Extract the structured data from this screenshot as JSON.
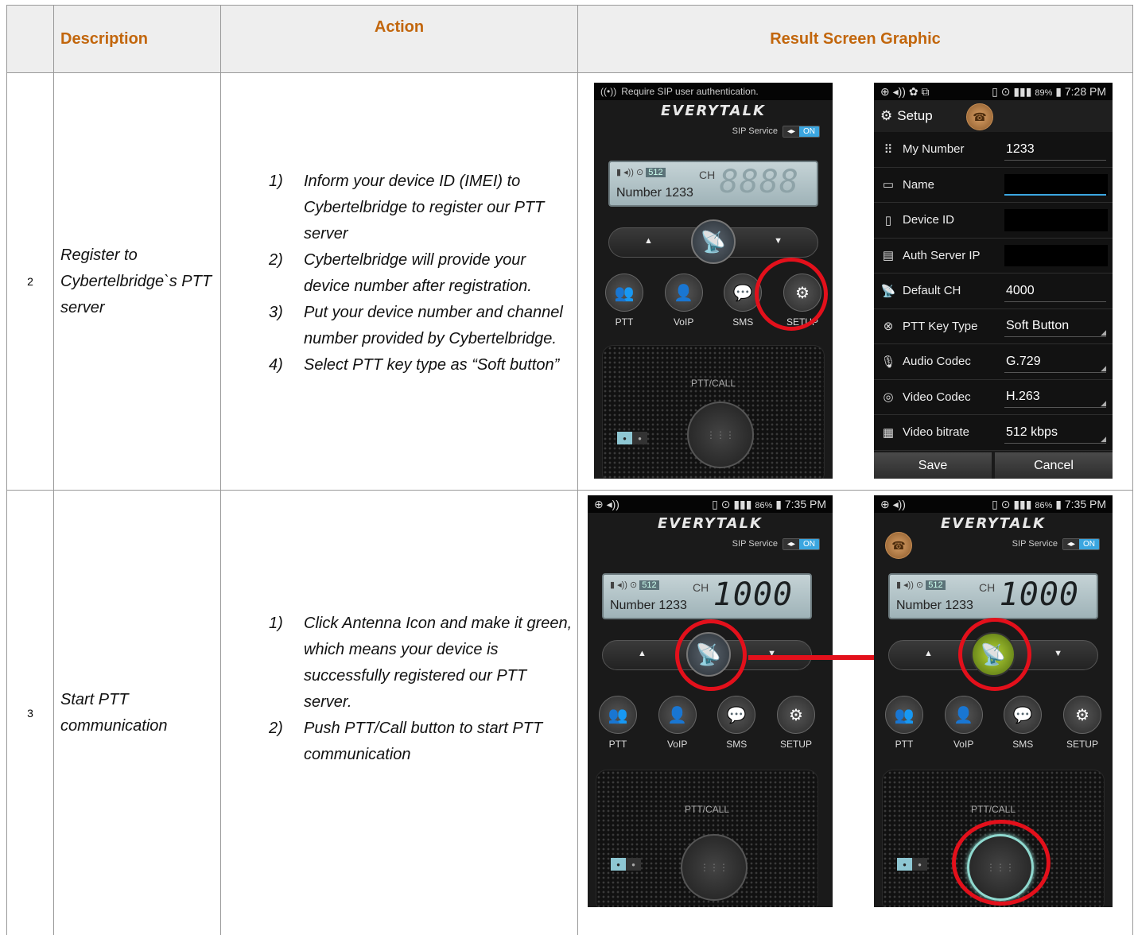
{
  "headers": {
    "number": "",
    "description": "Description",
    "action": "Action",
    "result": "Result Screen Graphic"
  },
  "rows": [
    {
      "number": "2",
      "description": "Register to Cybertelbridge`s PTT server",
      "steps": [
        {
          "num": "1)",
          "text": "Inform your device ID (IMEI) to Cybertelbridge to register our PTT server"
        },
        {
          "num": "2)",
          "text": "Cybertelbridge will provide your device number after registration."
        },
        {
          "num": "3)",
          "text": "Put your device number and channel number provided by Cybertelbridge."
        },
        {
          "num": "4)",
          "text": "Select PTT key type as “Soft button”"
        }
      ]
    },
    {
      "number": "3",
      "description": "Start PTT communication",
      "steps": [
        {
          "num": "1)",
          "text": "Click Antenna Icon and make it green, which means your device is successfully registered our PTT server."
        },
        {
          "num": "2)",
          "text": "Push PTT/Call button to start PTT communication"
        }
      ]
    }
  ],
  "phone_main": {
    "sip_notice": "Require SIP user authentication.",
    "logo": "EVERYTALK",
    "sip_label": "SIP Service",
    "sip_on": "ON",
    "lcd_badge": "512",
    "lcd_ch": "CH",
    "lcd_number": "Number 1233",
    "lcd_channel_empty": "8888",
    "lcd_channel_set": "1000",
    "buttons": [
      "PTT",
      "VoIP",
      "SMS",
      "SETUP"
    ],
    "ptt_call": "PTT/CALL",
    "status_time": "7:35 PM",
    "status_battery": "86%"
  },
  "phone_setup": {
    "status_time": "7:28 PM",
    "status_battery": "89%",
    "title": "Setup",
    "fields": [
      {
        "label": "My Number",
        "value": "1233",
        "icon": "keypad-icon"
      },
      {
        "label": "Name",
        "value": "",
        "icon": "name-card-icon"
      },
      {
        "label": "Device ID",
        "value": "",
        "icon": "phone-icon"
      },
      {
        "label": "Auth Server IP",
        "value": "",
        "icon": "server-icon"
      },
      {
        "label": "Default CH",
        "value": "4000",
        "icon": "antenna-icon"
      },
      {
        "label": "PTT Key Type",
        "value": "Soft Button",
        "icon": "key-icon"
      },
      {
        "label": "Audio Codec",
        "value": "G.729",
        "icon": "microphone-icon"
      },
      {
        "label": "Video Codec",
        "value": "H.263",
        "icon": "video-icon"
      },
      {
        "label": "Video bitrate",
        "value": "512 kbps",
        "icon": "bitrate-icon"
      }
    ],
    "save": "Save",
    "cancel": "Cancel"
  },
  "colors": {
    "header_text": "#c2660c",
    "highlight": "#e3101b",
    "sip_on": "#3ba6e0",
    "antenna_active": "#b7d736"
  }
}
